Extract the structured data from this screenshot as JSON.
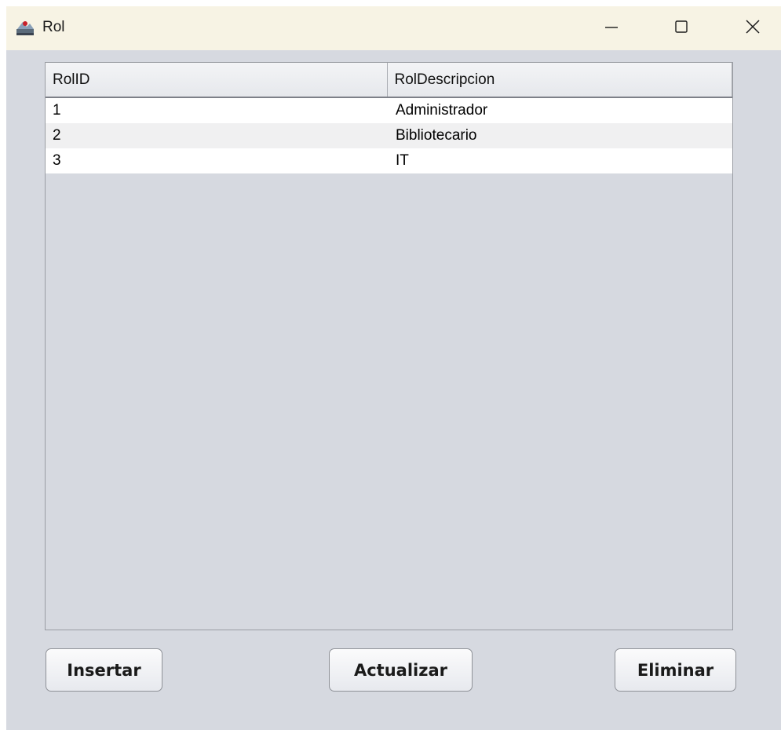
{
  "window": {
    "title": "Rol",
    "icon": "java-app-icon",
    "controls": {
      "minimize_icon": "minimize-icon",
      "maximize_icon": "maximize-icon",
      "close_icon": "close-icon"
    }
  },
  "table": {
    "columns": [
      "RolID",
      "RolDescripcion"
    ],
    "rows": [
      [
        "1",
        "Administrador"
      ],
      [
        "2",
        "Bibliotecario"
      ],
      [
        "3",
        "IT"
      ]
    ]
  },
  "buttons": {
    "insert_label": "Insertar",
    "update_label": "Actualizar",
    "delete_label": "Eliminar"
  },
  "colors": {
    "background": "#d6d9e0",
    "titlebar": "#f7f3e4",
    "row_alt": "#f0f0f1"
  }
}
